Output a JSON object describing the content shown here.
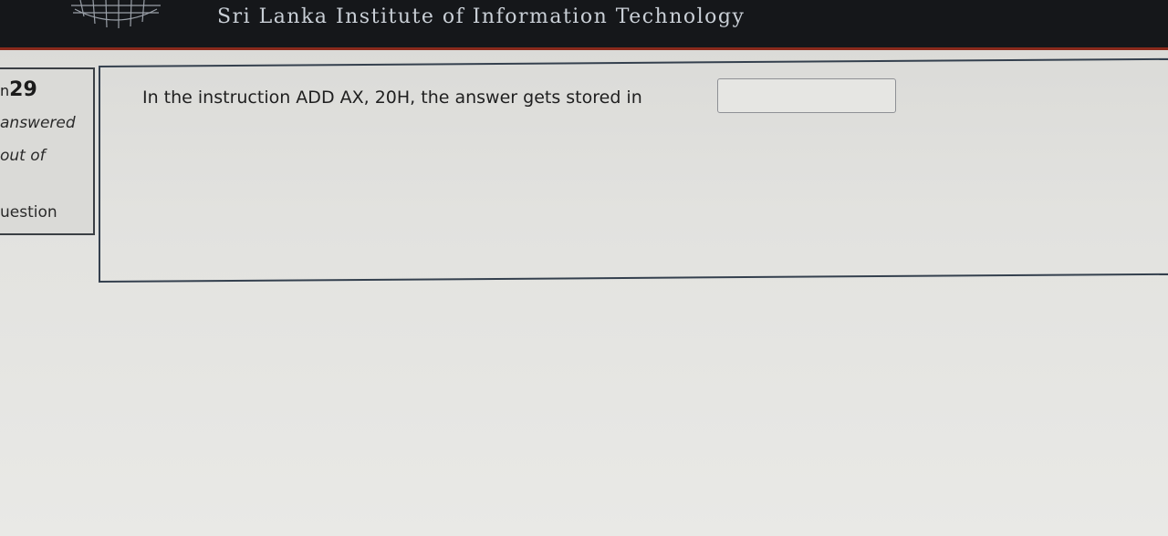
{
  "header": {
    "title": "Sri Lanka Institute of Information Technology",
    "logo_icon": "globe-grid-icon"
  },
  "question_info": {
    "number_prefix": "n",
    "number": "29",
    "status": "answered",
    "mark": "out of",
    "flag": "uestion"
  },
  "question": {
    "text": "In the instruction ADD AX, 20H, the answer gets stored in",
    "answer_value": ""
  },
  "colors": {
    "header_bg": "#15171a",
    "header_accent": "#8a2a1c",
    "title_text": "#c9cfd6"
  }
}
